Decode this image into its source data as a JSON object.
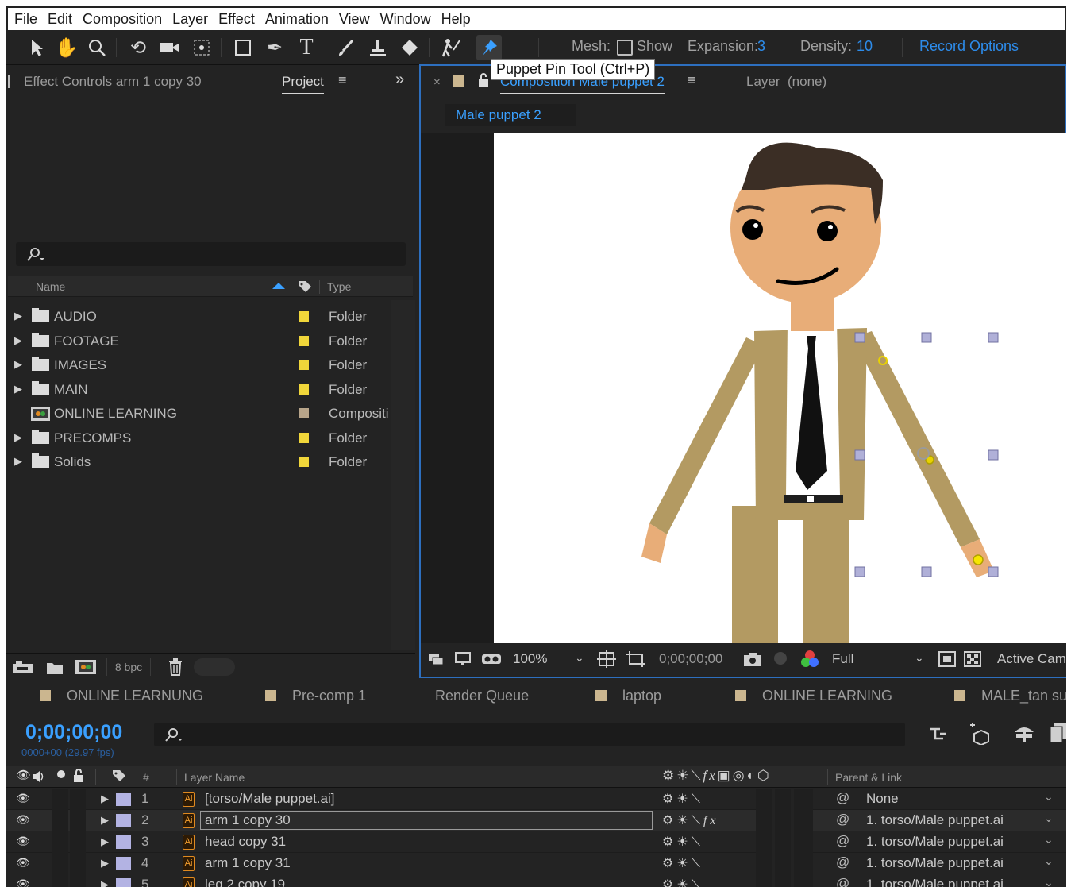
{
  "menu": [
    "File",
    "Edit",
    "Composition",
    "Layer",
    "Effect",
    "Animation",
    "View",
    "Window",
    "Help"
  ],
  "toolbar": {
    "tools": [
      "selection-tool",
      "hand-tool",
      "zoom-tool",
      "rotate-tool",
      "camera-tool",
      "pan-behind-tool",
      "rectangle-tool",
      "pen-tool",
      "type-tool",
      "brush-tool",
      "clone-stamp-tool",
      "eraser-tool",
      "roto-brush-tool",
      "puppet-pin-tool"
    ],
    "active_tool": "puppet-pin-tool",
    "mesh_label": "Mesh:",
    "show_label": "Show",
    "expansion_label": "Expansion:",
    "expansion_value": "3",
    "density_label": "Density:",
    "density_value": "10",
    "record_options": "Record Options",
    "tooltip": "Puppet Pin Tool (Ctrl+P)"
  },
  "left_panel": {
    "effect_controls_title": "Effect Controls arm 1 copy 30",
    "project_tab": "Project",
    "columns": {
      "name": "Name",
      "type": "Type"
    },
    "items": [
      {
        "name": "AUDIO",
        "type": "Folder",
        "kind": "folder",
        "color": "#f0d63a"
      },
      {
        "name": "FOOTAGE",
        "type": "Folder",
        "kind": "folder",
        "color": "#f0d63a"
      },
      {
        "name": "IMAGES",
        "type": "Folder",
        "kind": "folder",
        "color": "#f0d63a"
      },
      {
        "name": "MAIN",
        "type": "Folder",
        "kind": "folder",
        "color": "#f0d63a"
      },
      {
        "name": "ONLINE LEARNING",
        "type": "Compositi",
        "kind": "composition",
        "color": "#b8a58a"
      },
      {
        "name": "PRECOMPS",
        "type": "Folder",
        "kind": "folder",
        "color": "#f0d63a"
      },
      {
        "name": "Solids",
        "type": "Folder",
        "kind": "folder",
        "color": "#f0d63a"
      }
    ],
    "bpc": "8 bpc"
  },
  "comp_panel": {
    "tab_title": "Composition Male puppet 2",
    "layer_label": "Layer",
    "layer_value": "(none)",
    "breadcrumb": "Male puppet 2",
    "zoom": "100%",
    "timecode": "0;00;00;00",
    "resolution": "Full",
    "camera": "Active Cam"
  },
  "tabs": [
    {
      "label": "ONLINE LEARNUNG",
      "color": "#cbb68f"
    },
    {
      "label": "Pre-comp 1",
      "color": "#cbb68f"
    },
    {
      "label": "Render Queue",
      "color": ""
    },
    {
      "label": "laptop",
      "color": "#cbb68f"
    },
    {
      "label": "ONLINE LEARNING",
      "color": "#cbb68f"
    },
    {
      "label": "MALE_tan su",
      "color": "#cbb68f"
    }
  ],
  "timeline": {
    "timecode": "0;00;00;00",
    "frame_info": "0000+00 (29.97 fps)",
    "columns": {
      "num": "#",
      "layer_name": "Layer Name",
      "parent_link": "Parent & Link"
    },
    "layers": [
      {
        "num": "1",
        "name": "[torso/Male puppet.ai]",
        "parent": "None",
        "selected": false
      },
      {
        "num": "2",
        "name": "arm 1 copy 30",
        "parent": "1. torso/Male puppet.ai",
        "selected": true
      },
      {
        "num": "3",
        "name": "head copy 31",
        "parent": "1. torso/Male puppet.ai",
        "selected": false
      },
      {
        "num": "4",
        "name": "arm 1 copy 31",
        "parent": "1. torso/Male puppet.ai",
        "selected": false
      },
      {
        "num": "5",
        "name": "leg 2 copy 19",
        "parent": "1. torso/Male puppet.ai",
        "selected": false
      }
    ]
  },
  "colors": {
    "accent": "#2d8ceb",
    "panel_bg": "#232323",
    "folder_label": "#f0d63a",
    "layer_label": "#b3b3e3",
    "suit": "#b39a62",
    "skin": "#e8ad78",
    "hair": "#3b2e25"
  }
}
